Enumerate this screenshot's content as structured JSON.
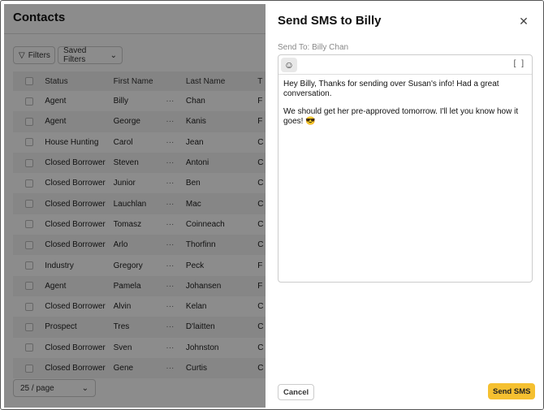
{
  "page": {
    "title": "Contacts",
    "filters_label": "Filters",
    "saved_filters_label": "Saved Filters",
    "pager_label": "25 / page"
  },
  "table": {
    "headers": {
      "status": "Status",
      "first": "First Name",
      "last": "Last Name",
      "t": "T"
    },
    "more_glyph": "···",
    "rows": [
      {
        "status": "Agent",
        "first": "Billy",
        "last": "Chan",
        "t": "F"
      },
      {
        "status": "Agent",
        "first": "George",
        "last": "Kanis",
        "t": "F"
      },
      {
        "status": "House Hunting",
        "first": "Carol",
        "last": "Jean",
        "t": "C"
      },
      {
        "status": "Closed Borrower",
        "first": "Steven",
        "last": "Antoni",
        "t": "C"
      },
      {
        "status": "Closed Borrower",
        "first": "Junior",
        "last": "Ben",
        "t": "C"
      },
      {
        "status": "Closed Borrower",
        "first": "Lauchlan",
        "last": "Mac",
        "t": "C"
      },
      {
        "status": "Closed Borrower",
        "first": "Tomasz",
        "last": "Coinneach",
        "t": "C"
      },
      {
        "status": "Closed Borrower",
        "first": "Arlo",
        "last": "Thorfinn",
        "t": "C"
      },
      {
        "status": "Industry",
        "first": "Gregory",
        "last": "Peck",
        "t": "F"
      },
      {
        "status": "Agent",
        "first": "Pamela",
        "last": "Johansen",
        "t": "F"
      },
      {
        "status": "Closed Borrower",
        "first": "Alvin",
        "last": "Kelan",
        "t": "C"
      },
      {
        "status": "Prospect",
        "first": "Tres",
        "last": "D'laitten",
        "t": "C"
      },
      {
        "status": "Closed Borrower",
        "first": "Sven",
        "last": "Johnston",
        "t": "C"
      },
      {
        "status": "Closed Borrower",
        "first": "Gene",
        "last": "Curtis",
        "t": "C"
      }
    ]
  },
  "drawer": {
    "title": "Send SMS to Billy",
    "close_glyph": "✕",
    "send_to": "Send To: Billy Chan",
    "emoji_glyph": "☺",
    "expand_glyph": "[ ]",
    "message_p1": "Hey Billy, Thanks for sending over Susan's info! Had a great conversation.",
    "message_p2": "We should get her pre-approved tomorrow. I'll let you know how it goes! 😎",
    "cancel_label": "Cancel",
    "send_label": "Send SMS"
  },
  "colors": {
    "accent": "#f5c030",
    "overlay": "rgba(0,0,0,0.45)"
  }
}
